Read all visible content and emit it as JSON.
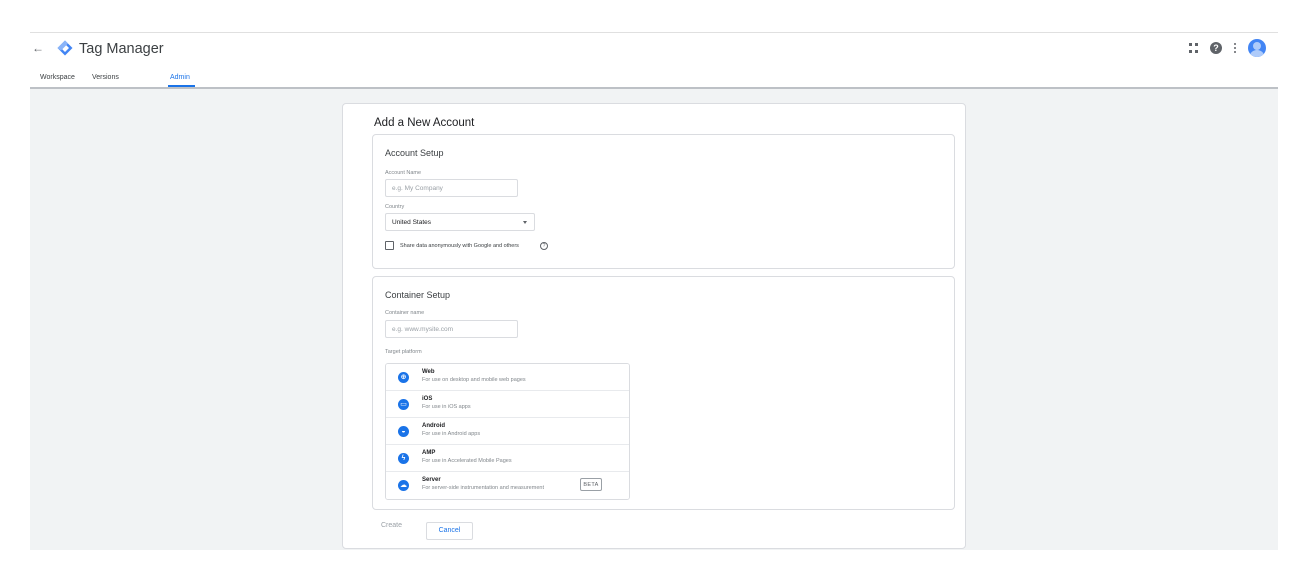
{
  "app": {
    "title": "Tag Manager",
    "back_icon": "arrow-back-icon",
    "logo_icon": "tag-manager-diamond-logo"
  },
  "header_icons": [
    "apps-grid-icon",
    "help-icon",
    "more-vert-icon",
    "account-avatar"
  ],
  "tabs": [
    {
      "label": "Workspace",
      "active": false
    },
    {
      "label": "Versions",
      "active": false
    },
    {
      "label": "Admin",
      "active": true
    }
  ],
  "form": {
    "title": "Add a New Account",
    "account_setup": {
      "title": "Account Setup",
      "account_name_label": "Account Name",
      "account_name_placeholder": "e.g. My Company",
      "account_name_value": "",
      "country_label": "Country",
      "country_value": "United States",
      "share_data_label": "Share data anonymously with Google and others",
      "share_data_checked": false
    },
    "container_setup": {
      "title": "Container Setup",
      "container_name_label": "Container name",
      "container_name_placeholder": "e.g. www.mysite.com",
      "container_name_value": "",
      "target_platform_label": "Target platform",
      "platforms": [
        {
          "name": "Web",
          "desc": "For use on desktop and mobile web pages",
          "icon": "globe-icon",
          "glyph": "⊕"
        },
        {
          "name": "iOS",
          "desc": "For use in iOS apps",
          "icon": "ios-icon",
          "glyph": "▭"
        },
        {
          "name": "Android",
          "desc": "For use in Android apps",
          "icon": "android-icon",
          "glyph": "◒"
        },
        {
          "name": "AMP",
          "desc": "For use in Accelerated Mobile Pages",
          "icon": "amp-icon",
          "glyph": "ϟ"
        },
        {
          "name": "Server",
          "desc": "For server-side instrumentation and measurement",
          "icon": "cloud-icon",
          "glyph": "☁",
          "badge": "BETA"
        }
      ]
    },
    "actions": {
      "create_label": "Create",
      "cancel_label": "Cancel"
    }
  },
  "colors": {
    "accent": "#1a73e8",
    "background": "#f1f3f4",
    "border": "#dadce0"
  }
}
